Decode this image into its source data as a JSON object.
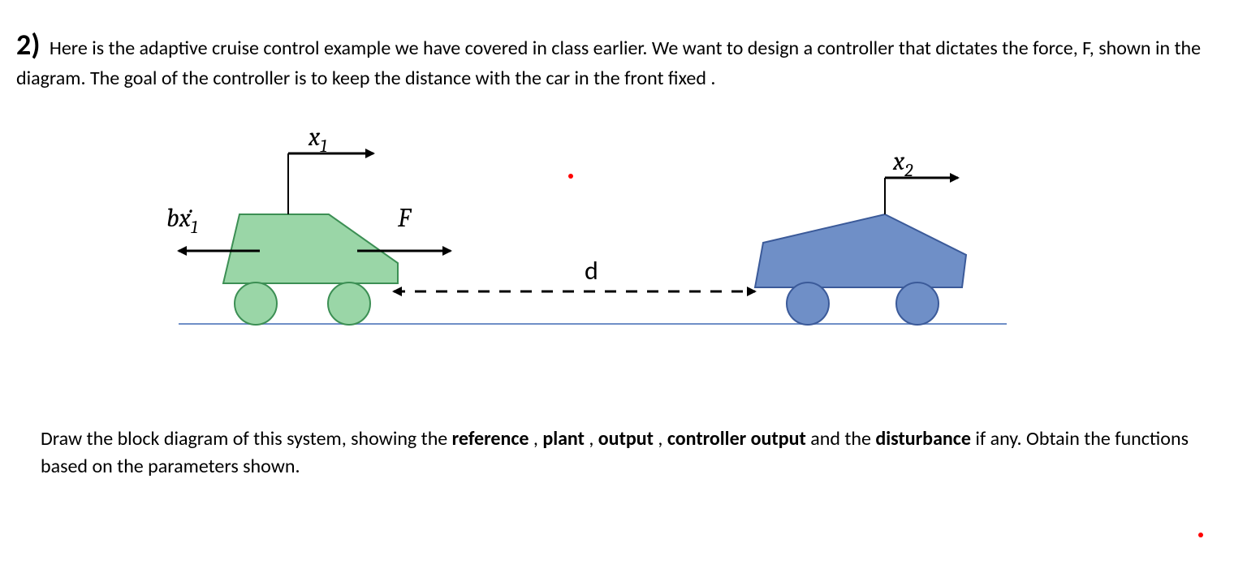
{
  "problem": {
    "number": "2)",
    "intro_part1": "Here is the adaptive cruise control example we have covered in class earlier. We want to design a controller that dictates the force, F, shown in the diagram. The goal of the controller is ",
    "intro_bold": "to keep the distance with the car in the front fixed",
    "intro_end": "."
  },
  "diagram": {
    "x1_label": "x",
    "x1_sub": "1",
    "x2_label": "x",
    "x2_sub": "2",
    "drag_label_b": "b",
    "drag_label_xdot": "ẋ",
    "drag_label_sub": "1",
    "force_label": "F",
    "distance_label": "d",
    "colors": {
      "car1_fill": "#9ad6a7",
      "car1_stroke": "#3c8f54",
      "car2_fill": "#6f8fc7",
      "car2_stroke": "#3b5a99",
      "ground": "#3b5a99",
      "arrow": "#000000"
    }
  },
  "instructions": {
    "line1_a": "Draw the block diagram of this system, showing the ",
    "ref": "reference",
    "sep1": ", ",
    "plant": "plant",
    "sep2": ", ",
    "output": "output",
    "sep3": ", ",
    "ctrl_out": "controller output",
    "line1_b": " and the ",
    "disturb": "disturbance",
    "line2": " if any. Obtain the functions based on the parameters shown."
  }
}
